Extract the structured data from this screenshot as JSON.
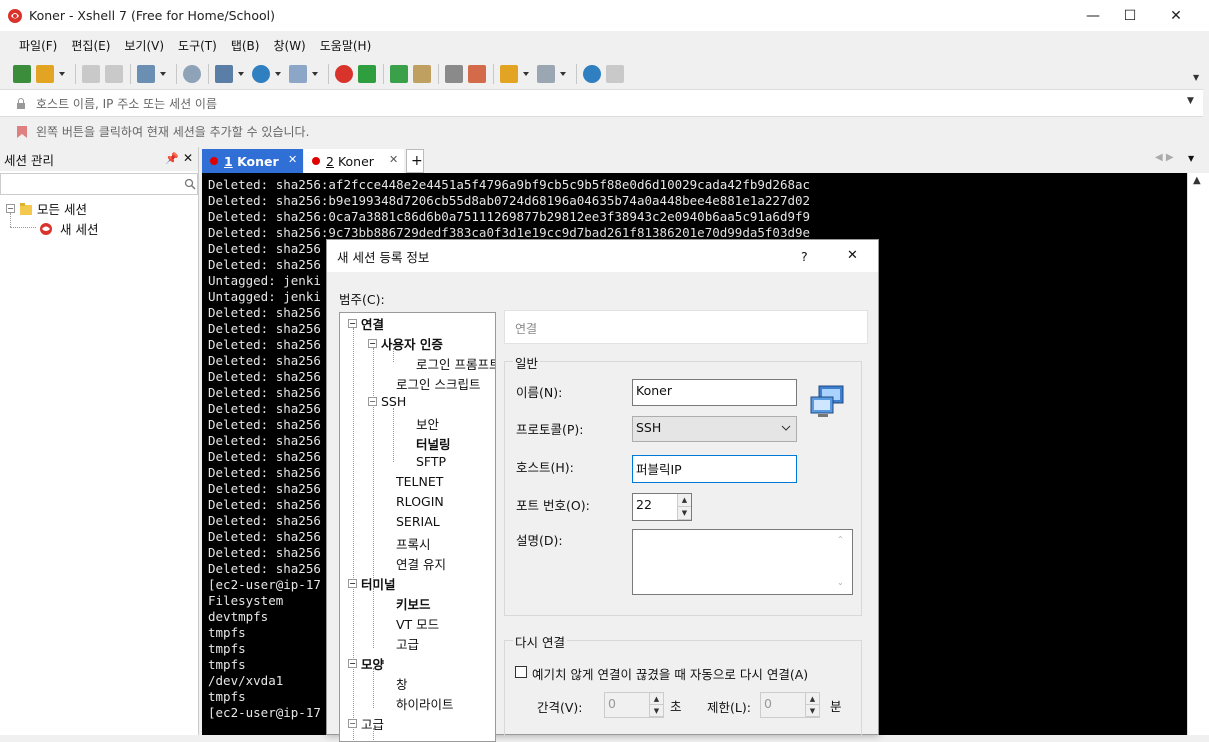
{
  "window": {
    "title": "Koner - Xshell 7 (Free for Home/School)",
    "controls": {
      "minimize": "—",
      "maximize": "☐",
      "close": "✕"
    }
  },
  "menu": [
    "파일(F)",
    "편집(E)",
    "보기(V)",
    "도구(T)",
    "탭(B)",
    "창(W)",
    "도움말(H)"
  ],
  "address_bar": {
    "placeholder": "호스트 이름, IP 주소 또는 세션 이름"
  },
  "hint_bar": {
    "text": "왼쪽 버튼을 클릭하여 현재 세션을 추가할 수 있습니다."
  },
  "session_panel": {
    "title": "세션 관리",
    "pin": "ᵖ",
    "close": "✕",
    "tree": {
      "root": "모든 세션",
      "child": "새 세션"
    }
  },
  "tabs": [
    {
      "label": "1 Koner",
      "num": "1",
      "name": "Koner",
      "active": true
    },
    {
      "label": "2 Koner",
      "num": "2",
      "name": "Koner",
      "active": false
    }
  ],
  "tab_add": "+",
  "terminal": {
    "lines": [
      "Deleted: sha256:af2fcce448e2e4451a5f4796a9bf9cb5c9b5f88e0d6d10029cada42fb9d268ac",
      "Deleted: sha256:b9e199348d7206cb55d8ab0724d68196a04635b74a0a448bee4e881e1a227d02",
      "Deleted: sha256:0ca7a3881c86d6b0a75111269877b29812ee3f38943c2e0940b6aa5c91a6d9f9",
      "Deleted: sha256:9c73bb886729dedf383ca0f3d1e19cc9d7bad261f81386201e70d99da5f03d9e",
      "Deleted: sha256",
      "Deleted: sha256",
      "Untagged: jenki",
      "Untagged: jenki                                                            18c110872e04c",
      "Deleted: sha256",
      "Deleted: sha256",
      "Deleted: sha256",
      "Deleted: sha256",
      "Deleted: sha256",
      "Deleted: sha256",
      "Deleted: sha256",
      "Deleted: sha256",
      "Deleted: sha256",
      "Deleted: sha256",
      "Deleted: sha256",
      "Deleted: sha256",
      "Deleted: sha256",
      "Deleted: sha256",
      "Deleted: sha256",
      "Deleted: sha256",
      "Deleted: sha256",
      "[ec2-user@ip-17",
      "Filesystem",
      "devtmpfs",
      "tmpfs",
      "tmpfs",
      "tmpfs",
      "/dev/xvda1",
      "tmpfs",
      "[ec2-user@ip-17"
    ]
  },
  "dialog": {
    "title": "새 세션 등록 정보",
    "help": "?",
    "close": "✕",
    "category_label": "범주(C):",
    "categories": {
      "connection": "연결",
      "user_auth": "사용자 인증",
      "login_prompt": "로그인 프롬프트",
      "login_script": "로그인 스크립트",
      "ssh": "SSH",
      "security": "보안",
      "tunneling": "터널링",
      "sftp": "SFTP",
      "telnet": "TELNET",
      "rlogin": "RLOGIN",
      "serial": "SERIAL",
      "proxy": "프록시",
      "keepalive": "연결 유지",
      "terminal": "터미널",
      "keyboard": "키보드",
      "vt_mode": "VT 모드",
      "advanced_t": "고급",
      "appearance": "모양",
      "window": "창",
      "highlight": "하이라이트",
      "advanced": "고급"
    },
    "panel_header": "연결",
    "general": {
      "title": "일반",
      "name_label": "이름(N):",
      "name_value": "Koner",
      "protocol_label": "프로토콜(P):",
      "protocol_value": "SSH",
      "host_label": "호스트(H):",
      "host_value": "퍼블릭IP",
      "port_label": "포트 번호(O):",
      "port_value": "22",
      "desc_label": "설명(D):",
      "desc_value": ""
    },
    "reconnect": {
      "title": "다시 연결",
      "auto_label": "예기치 않게 연결이 끊겼을 때 자동으로 다시 연결(A)",
      "auto_checked": false,
      "interval_label": "간격(V):",
      "interval_value": "0",
      "interval_unit": "초",
      "limit_label": "제한(L):",
      "limit_value": "0",
      "limit_unit": "분"
    }
  }
}
